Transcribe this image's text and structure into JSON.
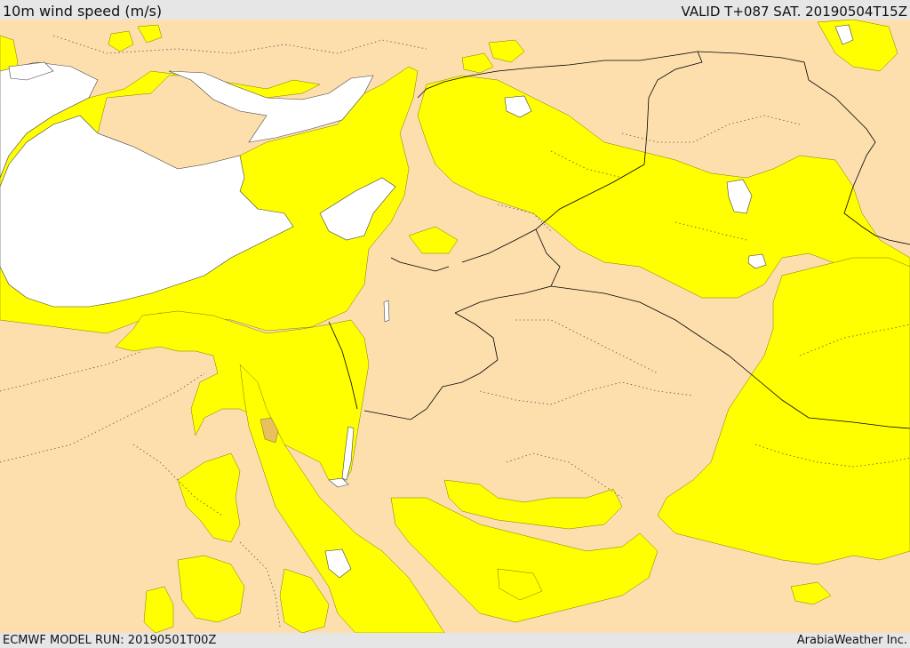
{
  "header": {
    "title": "10m wind speed (m/s)",
    "valid": "VALID T+087 SAT. 20190504T15Z"
  },
  "footer": {
    "model_run": "ECMWF MODEL RUN: 20190501T00Z",
    "credit": "ArabiaWeather Inc."
  },
  "colors": {
    "land": "#fddfae",
    "wind_zone": "#ffff00",
    "wind_zone_stronger": "#e8c060",
    "water": "#ffffff",
    "border": "#000000",
    "header_bg": "#e6e6e6"
  }
}
